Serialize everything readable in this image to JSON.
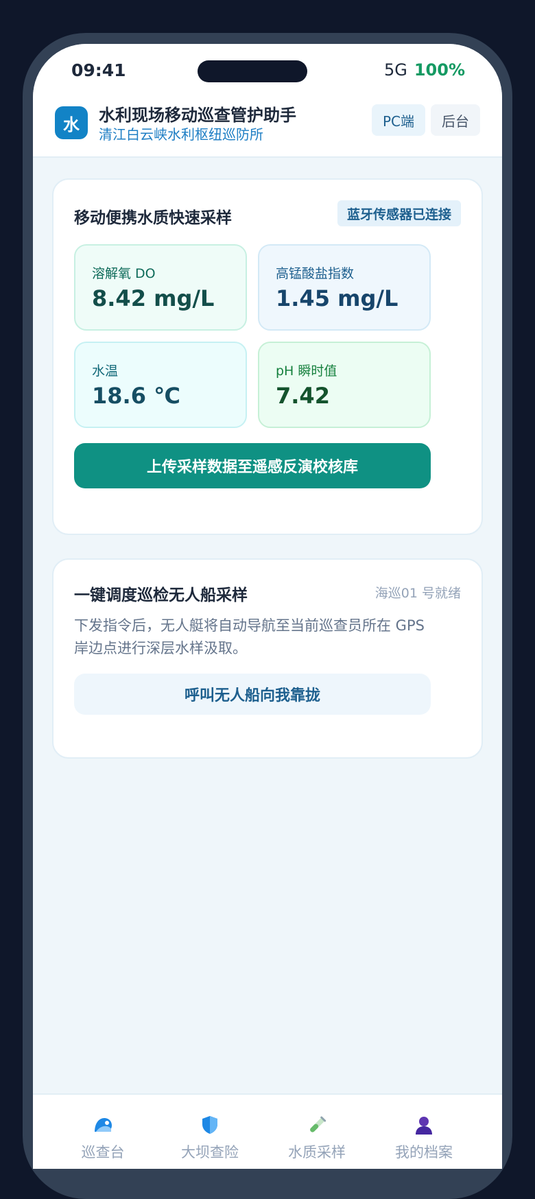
{
  "status_bar": {
    "time": "09:41",
    "network": "5G",
    "battery": "100%"
  },
  "header": {
    "logo_char": "水",
    "title": "水利现场移动巡查管护助手",
    "subtitle": "清江白云峡水利枢纽巡防所",
    "pc_button": "PC端",
    "admin_button": "后台"
  },
  "sampling_card": {
    "title": "移动便携水质快速采样",
    "sensor_status": "蓝牙传感器已连接",
    "metrics": [
      {
        "label": "溶解氧 DO",
        "value": "8.42 mg/L"
      },
      {
        "label": "高锰酸盐指数",
        "value": "1.45 mg/L"
      },
      {
        "label": "水温",
        "value": "18.6 ℃"
      },
      {
        "label": "pH 瞬时值",
        "value": "7.42"
      }
    ],
    "upload_button": "上传采样数据至遥感反演校核库"
  },
  "boat_card": {
    "title": "一键调度巡检无人船采样",
    "boat_status": "海巡01 号就绪",
    "description": "下发指令后，无人艇将自动导航至当前巡查员所在 GPS 岸边点进行深层水样汲取。",
    "call_button": "呼叫无人船向我靠拢"
  },
  "tab_bar": {
    "items": [
      {
        "label": "巡查台",
        "icon": "water-wave-icon"
      },
      {
        "label": "大坝查险",
        "icon": "shield-icon"
      },
      {
        "label": "水质采样",
        "icon": "test-tube-icon"
      },
      {
        "label": "我的档案",
        "icon": "user-icon"
      }
    ]
  },
  "colors": {
    "primary_blue": "#1283c6",
    "teal_button": "#0f9183",
    "battery_green": "#159a63"
  }
}
